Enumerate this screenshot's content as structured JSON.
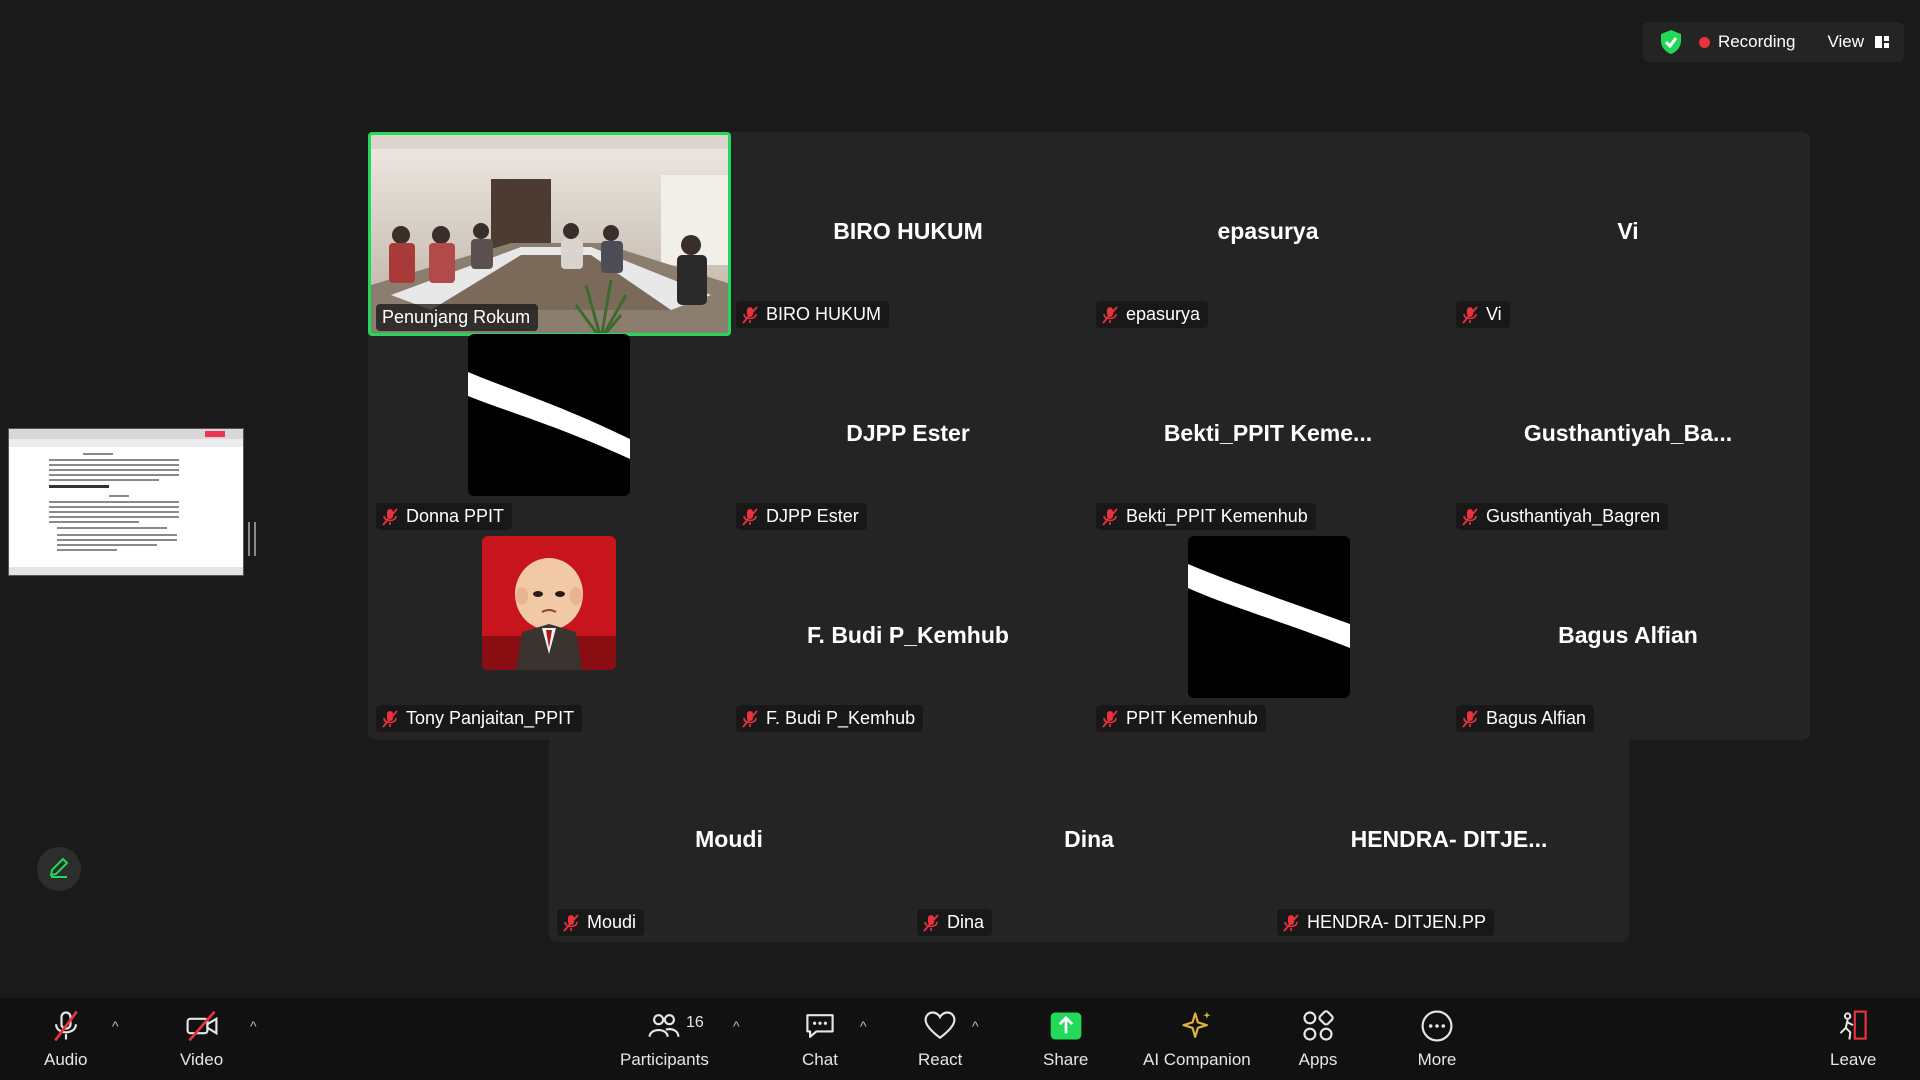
{
  "topbar": {
    "recording_label": "Recording",
    "view_label": "View",
    "shield_icon": "green-shield-check-icon",
    "accent_green": "#23d959",
    "recording_red": "#e8323c"
  },
  "participants": [
    {
      "display_name": "",
      "label": "Penunjang Rokum",
      "muted": false,
      "avatar": "room-video"
    },
    {
      "display_name": "BIRO HUKUM",
      "label": "BIRO HUKUM",
      "muted": true
    },
    {
      "display_name": "epasurya",
      "label": "epasurya",
      "muted": true
    },
    {
      "display_name": "Vi",
      "label": "Vi",
      "muted": true
    },
    {
      "display_name": "",
      "label": "Donna PPIT",
      "muted": true,
      "avatar": "brush-stroke"
    },
    {
      "display_name": "DJPP Ester",
      "label": "DJPP Ester",
      "muted": true
    },
    {
      "display_name": "Bekti_PPIT  Keme...",
      "label": "Bekti_PPIT Kemenhub",
      "muted": true
    },
    {
      "display_name": "Gusthantiyah_Ba...",
      "label": "Gusthantiyah_Bagren",
      "muted": true
    },
    {
      "display_name": "",
      "label": "Tony Panjaitan_PPIT",
      "muted": true,
      "avatar": "baby-boss"
    },
    {
      "display_name": "F. Budi P_Kemhub",
      "label": "F. Budi P_Kemhub",
      "muted": true
    },
    {
      "display_name": "",
      "label": "PPIT Kemenhub",
      "muted": true,
      "avatar": "brush-stroke"
    },
    {
      "display_name": "Bagus Alfian",
      "label": "Bagus Alfian",
      "muted": true
    },
    {
      "display_name": "Moudi",
      "label": "Moudi",
      "muted": true
    },
    {
      "display_name": "Dina",
      "label": "Dina",
      "muted": true
    },
    {
      "display_name": "HENDRA-  DITJE...",
      "label": "HENDRA- DITJEN.PP",
      "muted": true
    }
  ],
  "toolbar": {
    "audio": "Audio",
    "video": "Video",
    "participants": "Participants",
    "participants_count": "16",
    "chat": "Chat",
    "react": "React",
    "share": "Share",
    "ai_companion": "AI Companion",
    "apps": "Apps",
    "more": "More",
    "leave": "Leave",
    "share_color": "#23d959",
    "leave_color": "#e8323c"
  }
}
